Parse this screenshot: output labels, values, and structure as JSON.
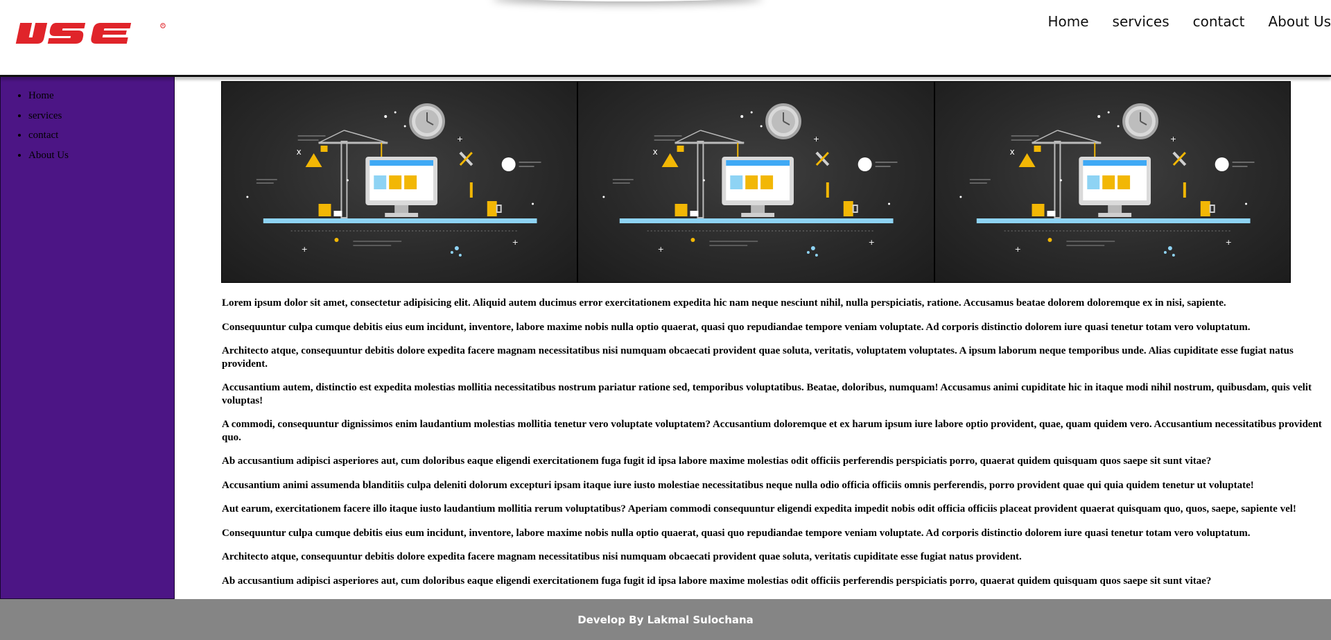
{
  "brand": {
    "logo_text": "IJSE",
    "logo_color": "#e0242a"
  },
  "nav": {
    "items": [
      {
        "label": "Home"
      },
      {
        "label": "services"
      },
      {
        "label": "contact"
      },
      {
        "label": "About Us"
      }
    ]
  },
  "sidebar": {
    "background": "#4c1585",
    "items": [
      {
        "label": "Home"
      },
      {
        "label": "services"
      },
      {
        "label": "contact"
      },
      {
        "label": "About Us"
      }
    ]
  },
  "banner": {
    "image_count": 3,
    "illustration": "under-construction-website"
  },
  "content": {
    "paragraphs": [
      "Lorem ipsum dolor sit amet, consectetur adipisicing elit. Aliquid autem ducimus error exercitationem expedita hic nam neque nesciunt nihil, nulla perspiciatis, ratione. Accusamus beatae dolorem doloremque ex in nisi, sapiente.",
      "Consequuntur culpa cumque debitis eius eum incidunt, inventore, labore maxime nobis nulla optio quaerat, quasi quo repudiandae tempore veniam voluptate. Ad corporis distinctio dolorem iure quasi tenetur totam vero voluptatum.",
      "Architecto atque, consequuntur debitis dolore expedita facere magnam necessitatibus nisi numquam obcaecati provident quae soluta, veritatis, voluptatem voluptates. A ipsum laborum neque temporibus unde. Alias cupiditate esse fugiat natus provident.",
      "Accusantium autem, distinctio est expedita molestias mollitia necessitatibus nostrum pariatur ratione sed, temporibus voluptatibus. Beatae, doloribus, numquam! Accusamus animi cupiditate hic in itaque modi nihil nostrum, quibusdam, quis velit voluptas!",
      "A commodi, consequuntur dignissimos enim laudantium molestias mollitia tenetur vero voluptate voluptatem? Accusantium doloremque et ex harum ipsum iure labore optio provident, quae, quam quidem vero. Accusantium necessitatibus provident quo.",
      "Ab accusantium adipisci asperiores aut, cum doloribus eaque eligendi exercitationem fuga fugit id ipsa labore maxime molestias odit officiis perferendis perspiciatis porro, quaerat quidem quisquam quos saepe sit sunt vitae?",
      "Accusantium animi assumenda blanditiis culpa deleniti dolorum excepturi ipsam itaque iure iusto molestiae necessitatibus neque nulla odio officia officiis omnis perferendis, porro provident quae qui quia quidem tenetur ut voluptate!",
      "Aut earum, exercitationem facere illo itaque iusto laudantium mollitia rerum voluptatibus? Aperiam commodi consequuntur eligendi expedita impedit nobis odit officia officiis placeat provident quaerat quisquam quo, quos, saepe, sapiente vel!",
      "Consequuntur culpa cumque debitis eius eum incidunt, inventore, labore maxime nobis nulla optio quaerat, quasi quo repudiandae tempore veniam voluptate. Ad corporis distinctio dolorem iure quasi tenetur totam vero voluptatum.",
      "Architecto atque, consequuntur debitis dolore expedita facere magnam necessitatibus nisi numquam obcaecati provident quae soluta, veritatis cupiditate esse fugiat natus provident.",
      "Ab accusantium adipisci asperiores aut, cum doloribus eaque eligendi exercitationem fuga fugit id ipsa labore maxime molestias odit officiis perferendis perspiciatis porro, quaerat quidem quisquam quos saepe sit sunt vitae?"
    ]
  },
  "footer": {
    "text": "Develop By Lakmal Sulochana",
    "background": "#858585"
  }
}
